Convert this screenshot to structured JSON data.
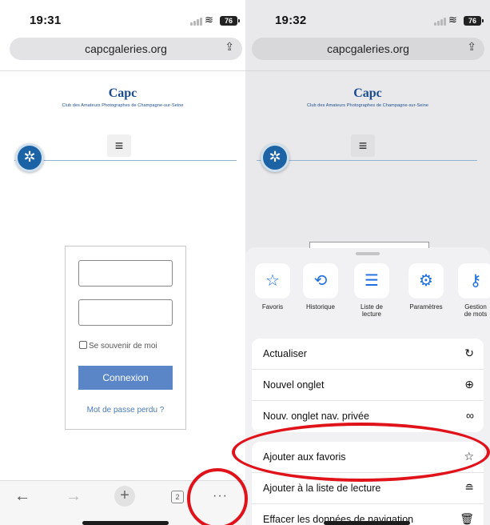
{
  "left": {
    "time": "19:31",
    "battery": "76",
    "url": "capcgaleries.org",
    "logo": "Capc",
    "tagline": "Club des Amateurs Photographes de Champagne-sur-Seine",
    "login": {
      "username_value": "",
      "password_value": "",
      "remember": "Se souvenir de moi",
      "submit": "Connexion",
      "lost_password": "Mot de passe perdu ?"
    },
    "toolbar": {
      "back": "←",
      "forward": "→",
      "new_tab": "+",
      "tab_count": "2",
      "more": "···"
    }
  },
  "right": {
    "time": "19:32",
    "battery": "76",
    "url": "capcgaleries.org",
    "logo": "Capc",
    "tagline": "Club des Amateurs Photographes de Champagne-sur-Seine",
    "shortcuts": [
      {
        "label": "Favoris",
        "icon": "star-icon"
      },
      {
        "label": "Historique",
        "icon": "history-icon"
      },
      {
        "label": "Liste de lecture",
        "icon": "reading-list-icon"
      },
      {
        "label": "Paramètres",
        "icon": "gear-icon"
      },
      {
        "label": "Gestion de mots",
        "icon": "key-icon"
      }
    ],
    "menu_group_1": [
      {
        "label": "Actualiser",
        "icon": "reload-icon"
      },
      {
        "label": "Nouvel onglet",
        "icon": "new-tab-icon"
      },
      {
        "label": "Nouv. onglet nav. privée",
        "icon": "incognito-icon"
      }
    ],
    "menu_group_2": [
      {
        "label": "Ajouter aux favoris",
        "icon": "star-outline-icon"
      },
      {
        "label": "Ajouter à la liste de lecture",
        "icon": "reading-list-add-icon"
      },
      {
        "label": "Effacer les données de navigation",
        "icon": "trash-icon"
      }
    ]
  },
  "colors": {
    "accent": "#1f6fe0",
    "annotation": "#e0121a",
    "button": "#5a86c8"
  }
}
